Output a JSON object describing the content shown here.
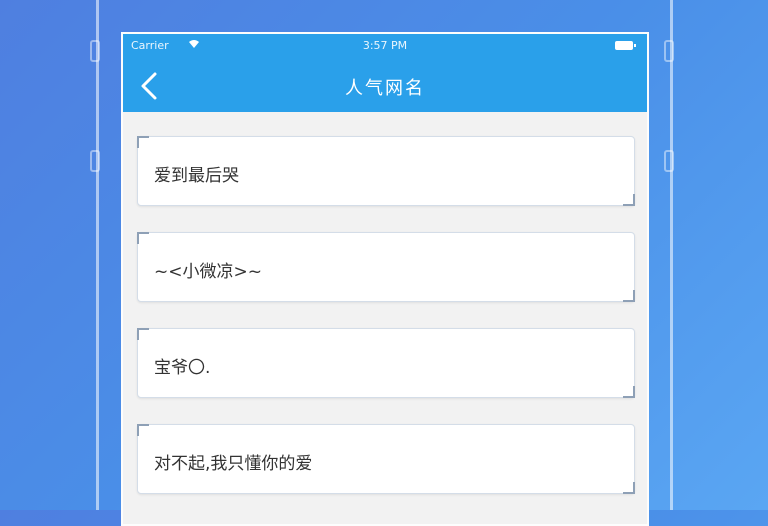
{
  "status_bar": {
    "carrier": "Carrier",
    "time": "3:57 PM"
  },
  "nav": {
    "title": "人气网名",
    "back_icon": "chevron-left-icon"
  },
  "names": [
    {
      "text": "爱到最后哭"
    },
    {
      "text": "~<小微凉>~"
    },
    {
      "text": "宝爷〇."
    },
    {
      "text": "对不起,我只懂你的爱"
    }
  ],
  "colors": {
    "nav_bg": "#2aa0ea",
    "background": "#4a8fe8",
    "card_bg": "#ffffff",
    "text": "#333333"
  }
}
